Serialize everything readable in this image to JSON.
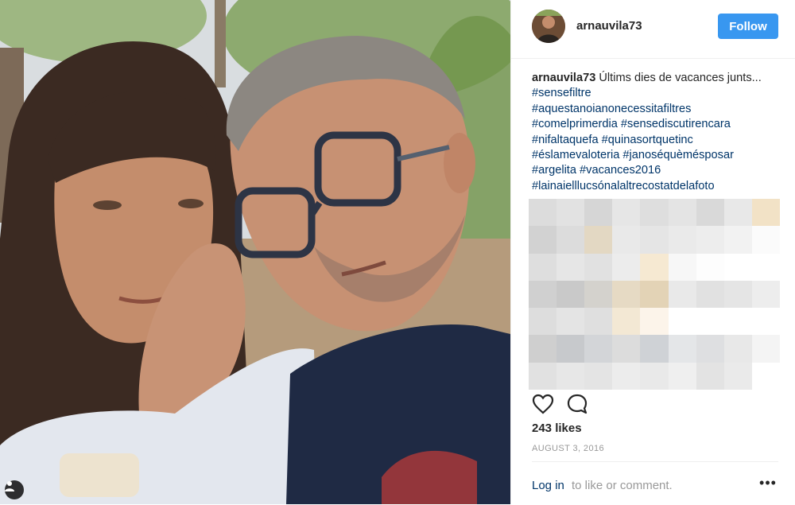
{
  "post": {
    "username": "arnauvila73",
    "follow_label": "Follow",
    "caption_user": "arnauvila73",
    "caption_text": "Últims dies de vacances junts...",
    "caption_inline_tag": "#sensefiltre",
    "hashtag_lines": [
      "#aquestanoianonecessitafiltres",
      "#comelprimerdia #sensediscutirencara",
      "#nifaltaquefa #quinasortquetinc",
      "#éslamevaloteria #janoséquèmésposar",
      "#argelita #vacances2016",
      "#lainaielllucsónalaltrecostatdelafoto"
    ],
    "likes": "243 likes",
    "date": "AUGUST 3, 2016",
    "login_link": "Log in",
    "login_rest": "to like or comment.",
    "more_label": "•••"
  },
  "icons": {
    "like": "heart-icon",
    "comment": "comment-icon",
    "tag": "person-tag-icon",
    "more": "more-options-icon"
  },
  "colors": {
    "follow_button": "#3897f0",
    "hashtag": "#003569",
    "muted": "#999999"
  }
}
